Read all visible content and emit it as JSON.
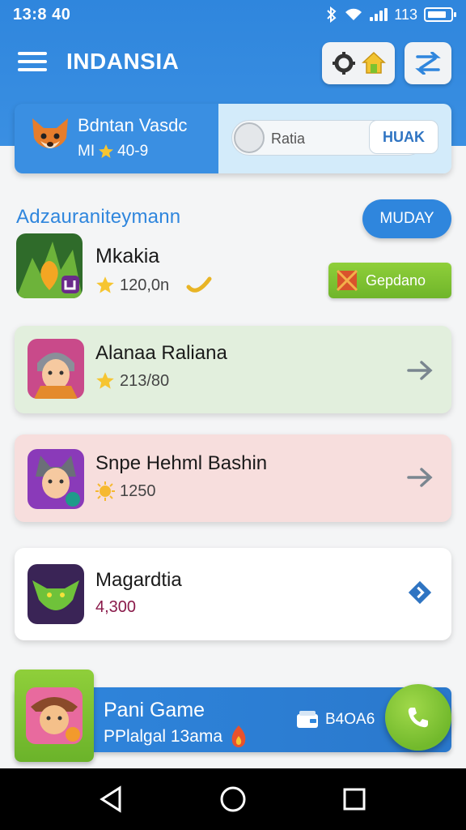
{
  "status_bar": {
    "time": "13:8 40",
    "battery_text": "113"
  },
  "app_bar": {
    "title": "INDANSIA"
  },
  "profile": {
    "name": "Bdntan Vasdc",
    "level_label": "MI",
    "stars": "40-9"
  },
  "toggle": {
    "label": "Ratia"
  },
  "huak_button": {
    "label": "HUAK"
  },
  "section": {
    "title": "Adzauraniteymann",
    "action_label": "MUDAY"
  },
  "games": [
    {
      "name": "Mkakia",
      "score": "120,0n",
      "button_label": "Gepdano"
    },
    {
      "name": "Alanaa Raliana",
      "score": "213/80"
    },
    {
      "name": "Snpe Hehml Bashin",
      "score": "1250"
    },
    {
      "name": "Magardtia",
      "score": "4,300"
    }
  ],
  "banner": {
    "title": "Pani Game",
    "subtitle": "PPlalgal 13ama",
    "meta": "B4OA6"
  },
  "colors": {
    "primary": "#2f86dd",
    "accent_green": "#7cc230",
    "card_green": "#e2efdd",
    "card_pink": "#f7dedd"
  },
  "icons": [
    "menu-icon",
    "settings-icon",
    "home-icon",
    "swap-icon",
    "fox-avatar-icon",
    "star-icon",
    "arrow-right-icon",
    "diamond-arrow-icon",
    "wallet-icon",
    "phone-icon",
    "flame-icon",
    "sun-icon",
    "back-icon",
    "home-nav-icon",
    "recents-icon"
  ]
}
